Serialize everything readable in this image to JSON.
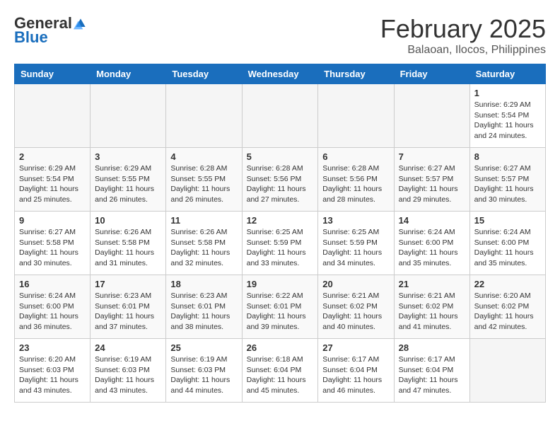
{
  "header": {
    "logo_general": "General",
    "logo_blue": "Blue",
    "month_year": "February 2025",
    "location": "Balaoan, Ilocos, Philippines"
  },
  "weekdays": [
    "Sunday",
    "Monday",
    "Tuesday",
    "Wednesday",
    "Thursday",
    "Friday",
    "Saturday"
  ],
  "weeks": [
    [
      {
        "day": "",
        "info": ""
      },
      {
        "day": "",
        "info": ""
      },
      {
        "day": "",
        "info": ""
      },
      {
        "day": "",
        "info": ""
      },
      {
        "day": "",
        "info": ""
      },
      {
        "day": "",
        "info": ""
      },
      {
        "day": "1",
        "info": "Sunrise: 6:29 AM\nSunset: 5:54 PM\nDaylight: 11 hours\nand 24 minutes."
      }
    ],
    [
      {
        "day": "2",
        "info": "Sunrise: 6:29 AM\nSunset: 5:54 PM\nDaylight: 11 hours\nand 25 minutes."
      },
      {
        "day": "3",
        "info": "Sunrise: 6:29 AM\nSunset: 5:55 PM\nDaylight: 11 hours\nand 26 minutes."
      },
      {
        "day": "4",
        "info": "Sunrise: 6:28 AM\nSunset: 5:55 PM\nDaylight: 11 hours\nand 26 minutes."
      },
      {
        "day": "5",
        "info": "Sunrise: 6:28 AM\nSunset: 5:56 PM\nDaylight: 11 hours\nand 27 minutes."
      },
      {
        "day": "6",
        "info": "Sunrise: 6:28 AM\nSunset: 5:56 PM\nDaylight: 11 hours\nand 28 minutes."
      },
      {
        "day": "7",
        "info": "Sunrise: 6:27 AM\nSunset: 5:57 PM\nDaylight: 11 hours\nand 29 minutes."
      },
      {
        "day": "8",
        "info": "Sunrise: 6:27 AM\nSunset: 5:57 PM\nDaylight: 11 hours\nand 30 minutes."
      }
    ],
    [
      {
        "day": "9",
        "info": "Sunrise: 6:27 AM\nSunset: 5:58 PM\nDaylight: 11 hours\nand 30 minutes."
      },
      {
        "day": "10",
        "info": "Sunrise: 6:26 AM\nSunset: 5:58 PM\nDaylight: 11 hours\nand 31 minutes."
      },
      {
        "day": "11",
        "info": "Sunrise: 6:26 AM\nSunset: 5:58 PM\nDaylight: 11 hours\nand 32 minutes."
      },
      {
        "day": "12",
        "info": "Sunrise: 6:25 AM\nSunset: 5:59 PM\nDaylight: 11 hours\nand 33 minutes."
      },
      {
        "day": "13",
        "info": "Sunrise: 6:25 AM\nSunset: 5:59 PM\nDaylight: 11 hours\nand 34 minutes."
      },
      {
        "day": "14",
        "info": "Sunrise: 6:24 AM\nSunset: 6:00 PM\nDaylight: 11 hours\nand 35 minutes."
      },
      {
        "day": "15",
        "info": "Sunrise: 6:24 AM\nSunset: 6:00 PM\nDaylight: 11 hours\nand 35 minutes."
      }
    ],
    [
      {
        "day": "16",
        "info": "Sunrise: 6:24 AM\nSunset: 6:00 PM\nDaylight: 11 hours\nand 36 minutes."
      },
      {
        "day": "17",
        "info": "Sunrise: 6:23 AM\nSunset: 6:01 PM\nDaylight: 11 hours\nand 37 minutes."
      },
      {
        "day": "18",
        "info": "Sunrise: 6:23 AM\nSunset: 6:01 PM\nDaylight: 11 hours\nand 38 minutes."
      },
      {
        "day": "19",
        "info": "Sunrise: 6:22 AM\nSunset: 6:01 PM\nDaylight: 11 hours\nand 39 minutes."
      },
      {
        "day": "20",
        "info": "Sunrise: 6:21 AM\nSunset: 6:02 PM\nDaylight: 11 hours\nand 40 minutes."
      },
      {
        "day": "21",
        "info": "Sunrise: 6:21 AM\nSunset: 6:02 PM\nDaylight: 11 hours\nand 41 minutes."
      },
      {
        "day": "22",
        "info": "Sunrise: 6:20 AM\nSunset: 6:02 PM\nDaylight: 11 hours\nand 42 minutes."
      }
    ],
    [
      {
        "day": "23",
        "info": "Sunrise: 6:20 AM\nSunset: 6:03 PM\nDaylight: 11 hours\nand 43 minutes."
      },
      {
        "day": "24",
        "info": "Sunrise: 6:19 AM\nSunset: 6:03 PM\nDaylight: 11 hours\nand 43 minutes."
      },
      {
        "day": "25",
        "info": "Sunrise: 6:19 AM\nSunset: 6:03 PM\nDaylight: 11 hours\nand 44 minutes."
      },
      {
        "day": "26",
        "info": "Sunrise: 6:18 AM\nSunset: 6:04 PM\nDaylight: 11 hours\nand 45 minutes."
      },
      {
        "day": "27",
        "info": "Sunrise: 6:17 AM\nSunset: 6:04 PM\nDaylight: 11 hours\nand 46 minutes."
      },
      {
        "day": "28",
        "info": "Sunrise: 6:17 AM\nSunset: 6:04 PM\nDaylight: 11 hours\nand 47 minutes."
      },
      {
        "day": "",
        "info": ""
      }
    ]
  ]
}
